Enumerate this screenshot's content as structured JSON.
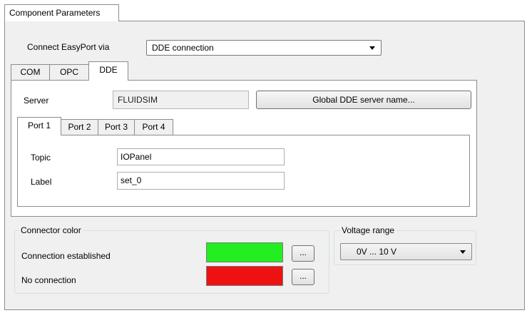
{
  "outer_tab": {
    "label": "Component Parameters"
  },
  "connect": {
    "label": "Connect EasyPort via",
    "value": "DDE connection"
  },
  "protocol_tabs": [
    {
      "label": "COM"
    },
    {
      "label": "OPC"
    },
    {
      "label": "DDE"
    }
  ],
  "dde": {
    "server_label": "Server",
    "server_value": "FLUIDSIM",
    "global_button": "Global DDE server name..."
  },
  "port_tabs": [
    {
      "label": "Port 1"
    },
    {
      "label": "Port 2"
    },
    {
      "label": "Port 3"
    },
    {
      "label": "Port 4"
    }
  ],
  "port": {
    "topic_label": "Topic",
    "topic_value": "IOPanel",
    "label_label": "Label",
    "label_value": "set_0"
  },
  "connector_color": {
    "title": "Connector color",
    "established_label": "Connection established",
    "established_color": "#22ee22",
    "none_label": "No connection",
    "none_color": "#ee1111",
    "browse_label": "..."
  },
  "voltage": {
    "title": "Voltage range",
    "value": "0V ... 10 V"
  }
}
